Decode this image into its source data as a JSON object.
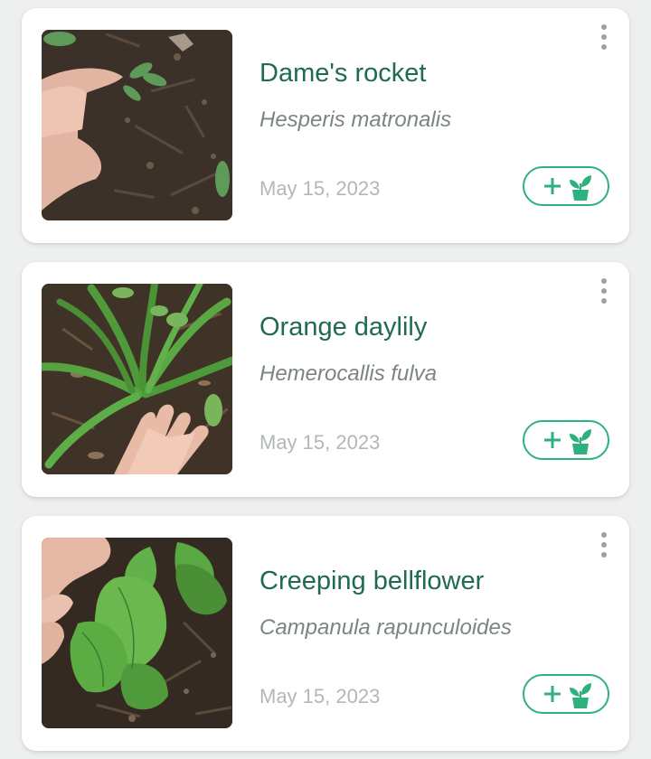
{
  "plants": [
    {
      "common_name": "Dame's rocket",
      "scientific_name": "Hesperis matronalis",
      "date": "May 15, 2023",
      "photo": "hand-touching-basal-rosette-seedling-on-mulch"
    },
    {
      "common_name": "Orange daylily",
      "scientific_name": "Hemerocallis fulva",
      "date": "May 15, 2023",
      "photo": "hand-beside-strappy-leaf-clump-on-mulch"
    },
    {
      "common_name": "Creeping bellflower",
      "scientific_name": "Campanula rapunculoides",
      "date": "May 15, 2023",
      "photo": "hand-holding-toothed-leaf-plant-on-mulch"
    }
  ],
  "icons": {
    "more": "more-vertical-icon",
    "add": "plus-icon",
    "plant": "potted-plant-icon"
  },
  "colors": {
    "background": "#eef0ef",
    "card": "#ffffff",
    "title": "#1e6b4d",
    "scientific": "#7b8582",
    "date": "#b1b8b5",
    "accent": "#2fb07f",
    "menu_dots": "#9aa19f"
  }
}
